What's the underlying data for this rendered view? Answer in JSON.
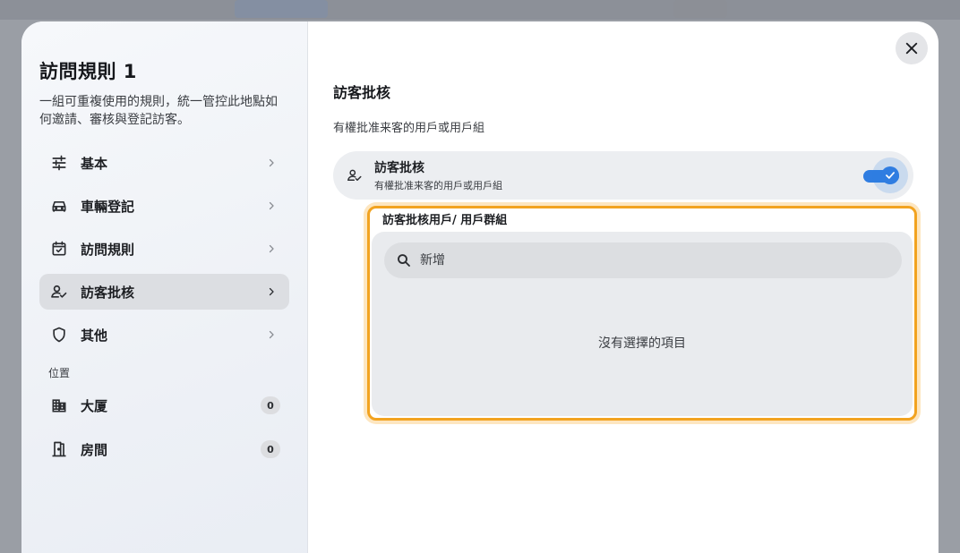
{
  "sidebar": {
    "title": "訪問規則 1",
    "description": "一組可重複使用的規則，統一管控此地點如何邀請、審核與登記訪客。",
    "nav": [
      {
        "label": "基本",
        "icon": "tune-icon"
      },
      {
        "label": "車輛登記",
        "icon": "car-icon"
      },
      {
        "label": "訪問規則",
        "icon": "calendar-check-icon"
      },
      {
        "label": "訪客批核",
        "icon": "person-check-icon"
      },
      {
        "label": "其他",
        "icon": "shield-icon"
      }
    ],
    "active_index": 3,
    "locations_label": "位置",
    "locations": [
      {
        "label": "大厦",
        "count": "0",
        "icon": "building-icon"
      },
      {
        "label": "房間",
        "count": "0",
        "icon": "door-icon"
      }
    ]
  },
  "content": {
    "title": "訪客批核",
    "subtitle": "有權批准来客的用戶或用戶組",
    "toggle": {
      "title": "訪客批核",
      "subtitle": "有權批准来客的用戶或用戶組",
      "enabled": true
    },
    "picker": {
      "label": "訪客批核用戶/ 用戶群組",
      "search_placeholder": "新增",
      "empty_text": "沒有選擇的項目"
    }
  },
  "colors": {
    "accent": "#2f7de1",
    "highlight_border": "#f2a320",
    "active_nav_bg": "#dcdee2"
  }
}
